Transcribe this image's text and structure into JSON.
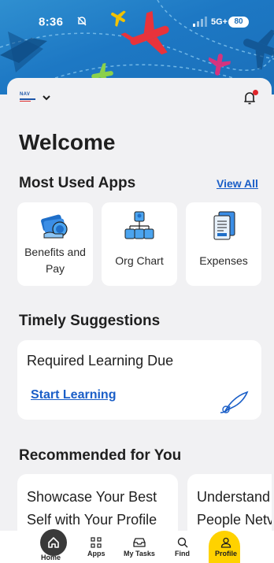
{
  "status_bar": {
    "time": "8:36",
    "network": "5G+",
    "battery": "80"
  },
  "header": {
    "logo_text": "NAV"
  },
  "welcome": "Welcome",
  "most_used": {
    "title": "Most Used Apps",
    "view_all": "View All",
    "apps": [
      {
        "label": "Benefits and Pay",
        "icon": "benefits-icon"
      },
      {
        "label": "Org Chart",
        "icon": "org-chart-icon"
      },
      {
        "label": "Expenses",
        "icon": "expenses-icon"
      }
    ]
  },
  "timely": {
    "title": "Timely Suggestions",
    "card_title": "Required Learning Due",
    "action": "Start Learning"
  },
  "recommended": {
    "title": "Recommended for You",
    "cards": [
      {
        "line1": "Showcase Your Best",
        "line2": "Self with Your Profile"
      },
      {
        "line1": "Understand",
        "line2": "People Netv"
      }
    ]
  },
  "bottom_nav": {
    "items": [
      {
        "label": "Home",
        "icon": "home-icon"
      },
      {
        "label": "Apps",
        "icon": "apps-grid-icon"
      },
      {
        "label": "My Tasks",
        "icon": "inbox-icon"
      },
      {
        "label": "Find",
        "icon": "search-icon"
      },
      {
        "label": "Profile",
        "icon": "person-icon"
      }
    ],
    "active": "Profile"
  },
  "colors": {
    "banner": "#1d78c4",
    "link": "#1a5ec7",
    "active_tab": "#ffd200",
    "notification_dot": "#e0262b"
  }
}
